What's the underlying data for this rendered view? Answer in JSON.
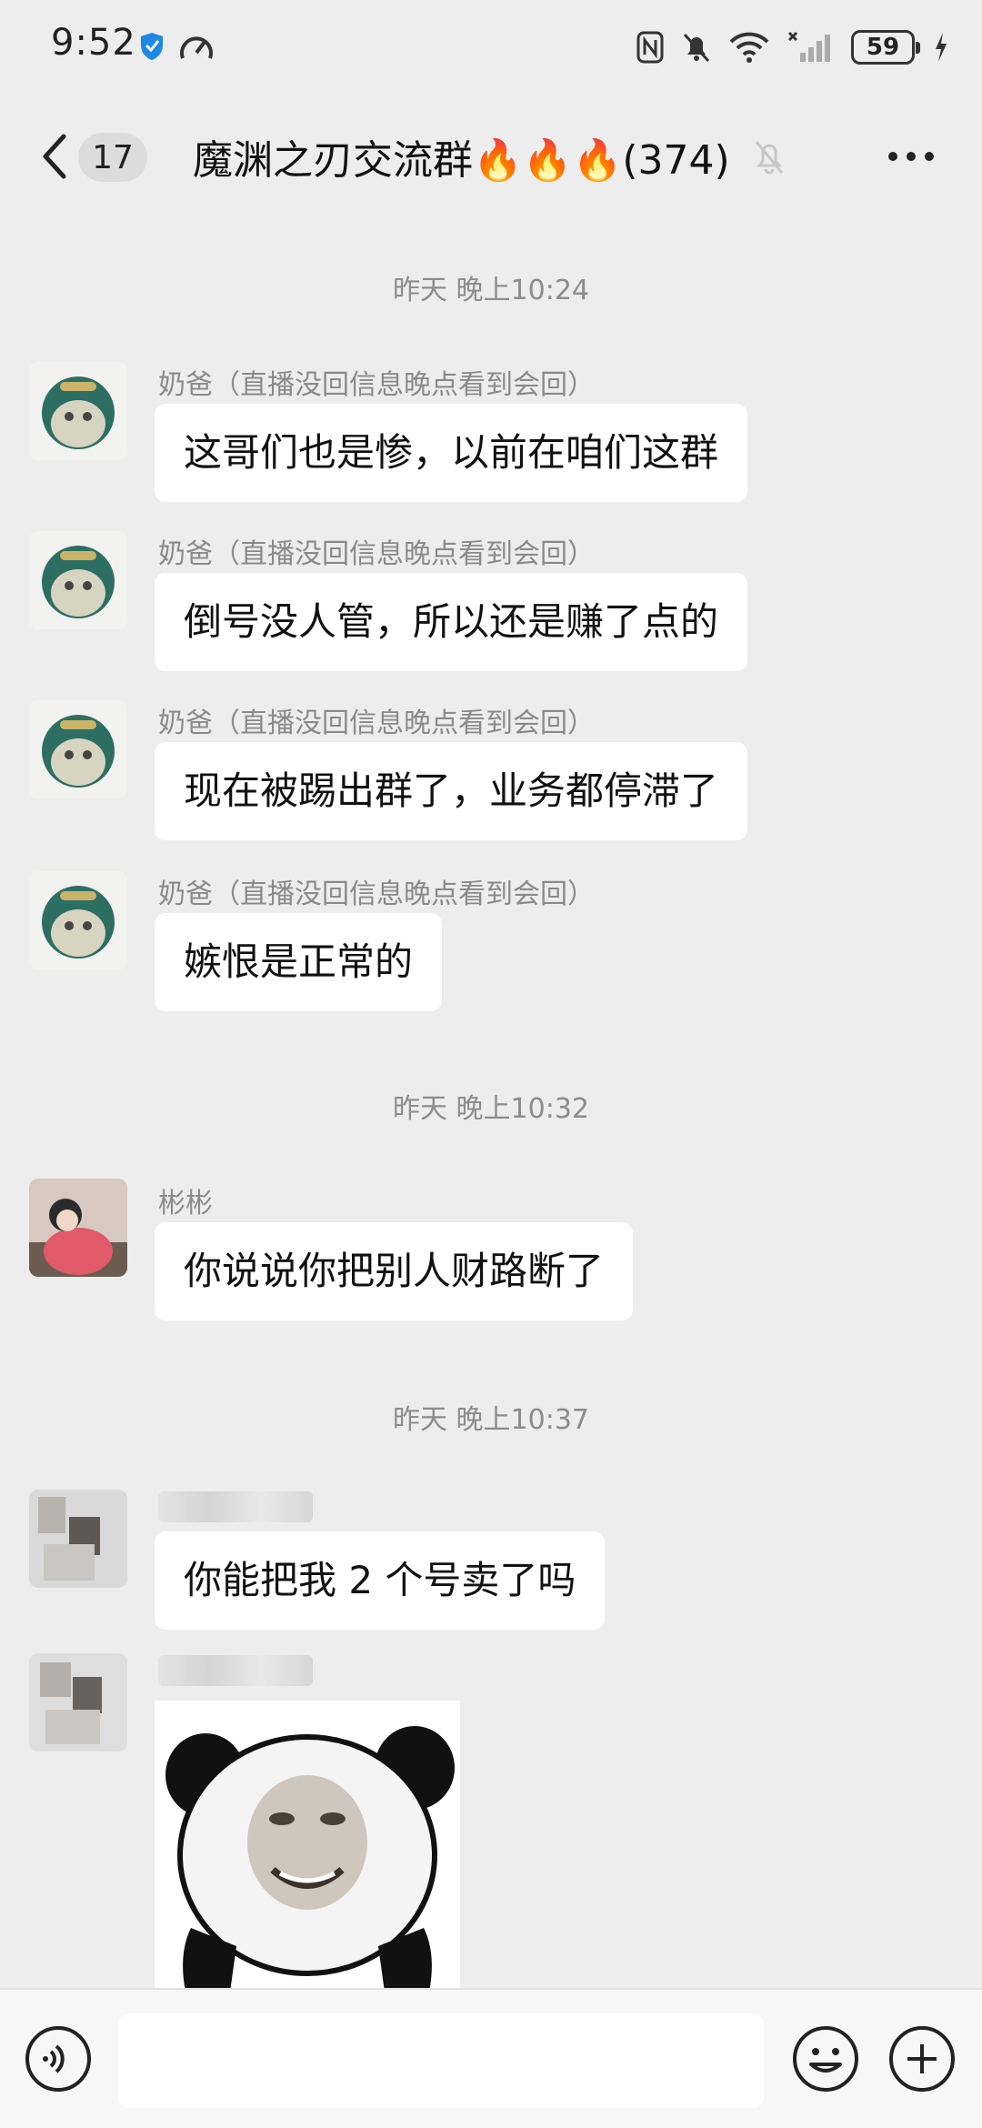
{
  "status_bar": {
    "time": "9:52",
    "battery": "59",
    "icons": [
      "shield-icon",
      "speedometer-icon",
      "nfc-icon",
      "bell-off-icon",
      "wifi-icon",
      "signal-icon",
      "charging-icon"
    ]
  },
  "header": {
    "back_icon": "chevron-left-icon",
    "unread_count": "17",
    "title": "魔渊之刃交流群🔥🔥🔥(374)",
    "mute_icon": "bell-off-icon",
    "more_icon": "more-dots-icon"
  },
  "chat": {
    "timestamps": [
      "昨天 晚上10:24",
      "昨天 晚上10:32",
      "昨天 晚上10:37"
    ],
    "messages": [
      {
        "sender": "奶爸（直播没回信息晚点看到会回）",
        "text": "这哥们也是惨，以前在咱们这群"
      },
      {
        "sender": "奶爸（直播没回信息晚点看到会回）",
        "text": "倒号没人管，所以还是赚了点的"
      },
      {
        "sender": "奶爸（直播没回信息晚点看到会回）",
        "text": "现在被踢出群了，业务都停滞了"
      },
      {
        "sender": "奶爸（直播没回信息晚点看到会回）",
        "text": "嫉恨是正常的"
      },
      {
        "sender": "彬彬",
        "text": "你说说你把别人财路断了"
      },
      {
        "sender": "",
        "text": "你能把我 2 个号卖了吗"
      },
      {
        "sender": "",
        "sticker": "panda-face-sticker"
      }
    ]
  },
  "input_bar": {
    "voice_icon": "voice-icon",
    "placeholder": "",
    "emoji_icon": "emoji-icon",
    "plus_icon": "plus-circle-icon"
  },
  "colors": {
    "background": "#ededed",
    "bubble": "#ffffff",
    "timestamp_text": "#8c8c8c",
    "sender_text": "#8a8a8a"
  }
}
